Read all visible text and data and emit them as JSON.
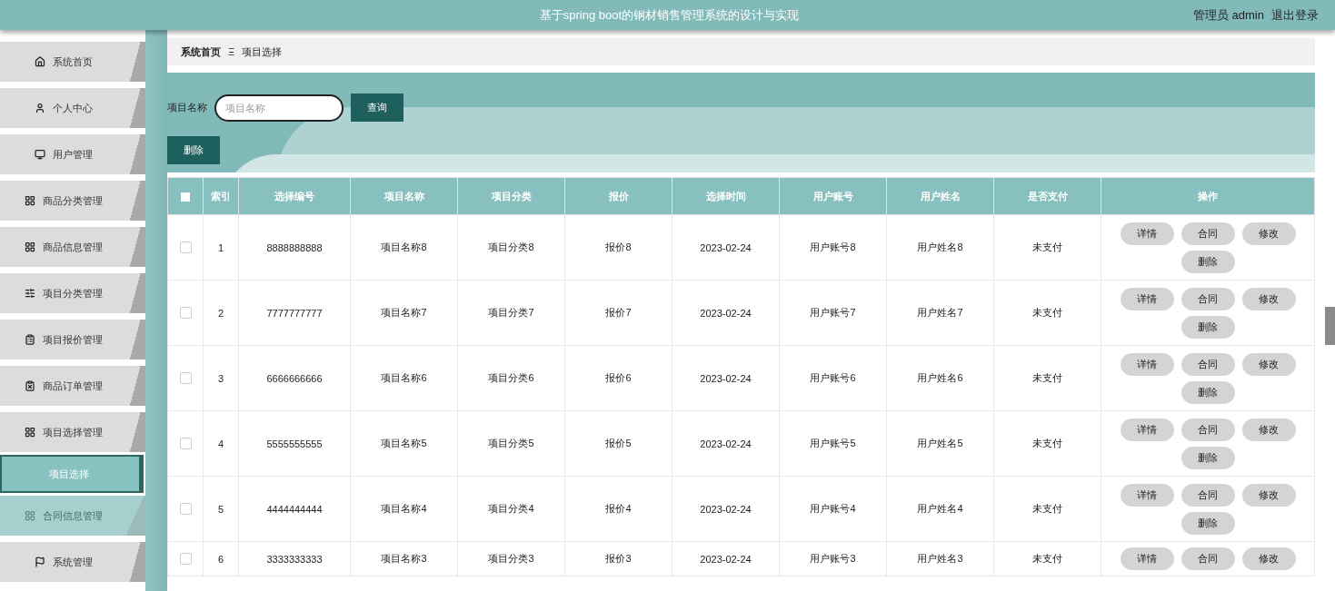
{
  "header": {
    "title": "基于spring boot的钢材销售管理系统的设计与实现",
    "user": "管理员 admin",
    "logout": "退出登录"
  },
  "sidebar": {
    "items": [
      {
        "label": "系统首页",
        "hover": false
      },
      {
        "label": "个人中心",
        "hover": false
      },
      {
        "label": "用户管理",
        "hover": false
      },
      {
        "label": "商品分类管理",
        "hover": false
      },
      {
        "label": "商品信息管理",
        "hover": false
      },
      {
        "label": "项目分类管理",
        "hover": false
      },
      {
        "label": "项目报价管理",
        "hover": false
      },
      {
        "label": "商品订单管理",
        "hover": false
      },
      {
        "label": "项目选择管理",
        "hover": false,
        "children": [
          {
            "label": "项目选择",
            "selected": true
          }
        ]
      },
      {
        "label": "合同信息管理",
        "hover": true
      },
      {
        "label": "系统管理",
        "hover": false
      }
    ]
  },
  "breadcrumb": {
    "home": "系统首页",
    "separator": "Ξ",
    "current": "项目选择"
  },
  "search": {
    "label": "项目名称",
    "placeholder": "项目名称",
    "button": "查询"
  },
  "toolbar": {
    "delete": "删除"
  },
  "table": {
    "all_checked": false,
    "columns": [
      "索引",
      "选择编号",
      "项目名称",
      "项目分类",
      "报价",
      "选择时间",
      "用户账号",
      "用户姓名",
      "是否支付",
      "操作"
    ],
    "rows": [
      {
        "checked": false,
        "cells": [
          "1",
          "8888888888",
          "项目名称8",
          "项目分类8",
          "报价8",
          "2023-02-24",
          "用户账号8",
          "用户姓名8",
          "未支付"
        ],
        "actions": [
          "详情",
          "合同",
          "修改",
          "删除"
        ]
      },
      {
        "checked": false,
        "cells": [
          "2",
          "7777777777",
          "项目名称7",
          "项目分类7",
          "报价7",
          "2023-02-24",
          "用户账号7",
          "用户姓名7",
          "未支付"
        ],
        "actions": [
          "详情",
          "合同",
          "修改",
          "删除"
        ]
      },
      {
        "checked": false,
        "cells": [
          "3",
          "6666666666",
          "项目名称6",
          "项目分类6",
          "报价6",
          "2023-02-24",
          "用户账号6",
          "用户姓名6",
          "未支付"
        ],
        "actions": [
          "详情",
          "合同",
          "修改",
          "删除"
        ]
      },
      {
        "checked": false,
        "cells": [
          "4",
          "5555555555",
          "项目名称5",
          "项目分类5",
          "报价5",
          "2023-02-24",
          "用户账号5",
          "用户姓名5",
          "未支付"
        ],
        "actions": [
          "详情",
          "合同",
          "修改",
          "删除"
        ]
      },
      {
        "checked": false,
        "cells": [
          "5",
          "4444444444",
          "项目名称4",
          "项目分类4",
          "报价4",
          "2023-02-24",
          "用户账号4",
          "用户姓名4",
          "未支付"
        ],
        "actions": [
          "详情",
          "合同",
          "修改",
          "删除"
        ]
      },
      {
        "checked": false,
        "cells": [
          "6",
          "3333333333",
          "项目名称3",
          "项目分类3",
          "报价3",
          "2023-02-24",
          "用户账号3",
          "用户姓名3",
          "未支付"
        ],
        "actions": [
          "详情",
          "合同",
          "修改"
        ]
      }
    ]
  }
}
